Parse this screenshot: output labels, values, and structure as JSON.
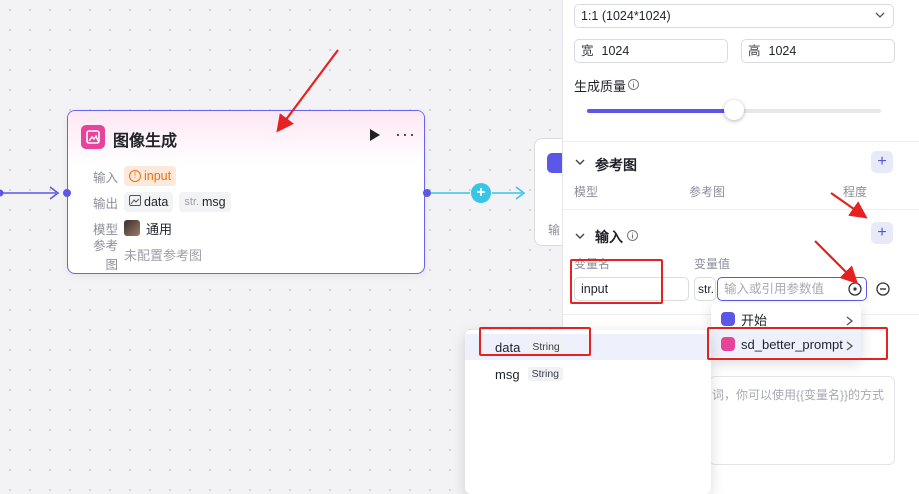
{
  "node": {
    "title": "图像生成",
    "more": "···",
    "input_label": "输入",
    "input_value": "input",
    "output_label": "输出",
    "output_data": "data",
    "output_msg_type": "str.",
    "output_msg": "msg",
    "model_label": "模型",
    "model_value": "通用",
    "ref_label": "参考图",
    "ref_value": "未配置参考图"
  },
  "side_node": {
    "label": "输"
  },
  "panel": {
    "ratio": "1:1 (1024*1024)",
    "width_label": "宽",
    "width_value": "1024",
    "height_label": "高",
    "height_value": "1024",
    "quality_label": "生成质量",
    "quality_level": 0.5,
    "ref_section": "参考图",
    "ref_cols": [
      "模型",
      "参考图",
      "程度"
    ],
    "input_section": "输入",
    "var_name_head": "变量名",
    "var_value_head": "变量值",
    "var_name": "input",
    "var_type": "str.",
    "var_placeholder": "输入或引用参数值",
    "prompt_hint": "词，你可以使用{{变量名}}的方式"
  },
  "menu1": {
    "items": [
      "开始",
      "sd_better_prompt"
    ]
  },
  "menu2": {
    "items": [
      {
        "name": "data",
        "type": "String"
      },
      {
        "name": "msg",
        "type": "String"
      }
    ]
  },
  "colors": {
    "accent": "#5b57e8",
    "brand_pink": "#e7439a",
    "annotation_red": "#e52222",
    "edge_cyan": "#38c5e8"
  }
}
